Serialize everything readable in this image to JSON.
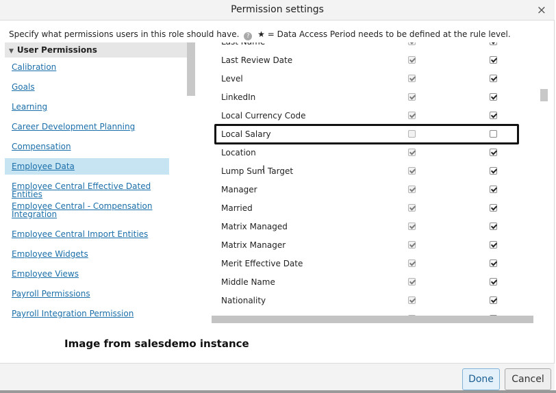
{
  "dialog": {
    "title": "Permission settings",
    "close_glyph": "×",
    "instruction_text": "Specify what permissions users in this role should have.",
    "help_glyph": "?",
    "legend_star": "★",
    "legend_text": "= Data Access Period needs to be defined at the rule level."
  },
  "left_panel": {
    "section_title": "User Permissions",
    "items": [
      {
        "label": "Calibration",
        "selected": false
      },
      {
        "label": "Goals",
        "selected": false
      },
      {
        "label": "Learning",
        "selected": false
      },
      {
        "label": "Career Development Planning",
        "selected": false
      },
      {
        "label": "Compensation",
        "selected": false
      },
      {
        "label": "Employee Data",
        "selected": true
      },
      {
        "label": "Employee Central Effective Dated Entities",
        "selected": false
      },
      {
        "label": "Employee Central - Compensation Integration",
        "selected": false
      },
      {
        "label": "Employee Central Import Entities",
        "selected": false
      },
      {
        "label": "Employee Widgets",
        "selected": false
      },
      {
        "label": "Employee Views",
        "selected": false
      },
      {
        "label": "Payroll Permissions",
        "selected": false
      },
      {
        "label": "Payroll Integration Permission",
        "selected": false
      }
    ]
  },
  "permissions": {
    "rows": [
      {
        "label": "Last Name",
        "view": true,
        "edit": true
      },
      {
        "label": "Last Review Date",
        "view": true,
        "edit": true
      },
      {
        "label": "Level",
        "view": true,
        "edit": true
      },
      {
        "label": "LinkedIn",
        "view": true,
        "edit": true
      },
      {
        "label": "Local Currency Code",
        "view": true,
        "edit": true
      },
      {
        "label": "Local Salary",
        "view": false,
        "edit": false
      },
      {
        "label": "Location",
        "view": true,
        "edit": true
      },
      {
        "label": "Lump Sum Target",
        "view": true,
        "edit": true
      },
      {
        "label": "Manager",
        "view": true,
        "edit": true
      },
      {
        "label": "Married",
        "view": true,
        "edit": true
      },
      {
        "label": "Matrix Managed",
        "view": true,
        "edit": true
      },
      {
        "label": "Matrix Manager",
        "view": true,
        "edit": true
      },
      {
        "label": "Merit Effective Date",
        "view": true,
        "edit": true
      },
      {
        "label": "Middle Name",
        "view": true,
        "edit": true
      },
      {
        "label": "Nationality",
        "view": true,
        "edit": true
      },
      {
        "label": "",
        "view": true,
        "edit": true
      }
    ]
  },
  "caption": "Image from salesdemo instance",
  "footer": {
    "done_label": "Done",
    "cancel_label": "Cancel"
  },
  "colors": {
    "link": "#1a6ea9",
    "selected_bg": "#c7e4f3",
    "done_border": "#7fb2d6"
  }
}
